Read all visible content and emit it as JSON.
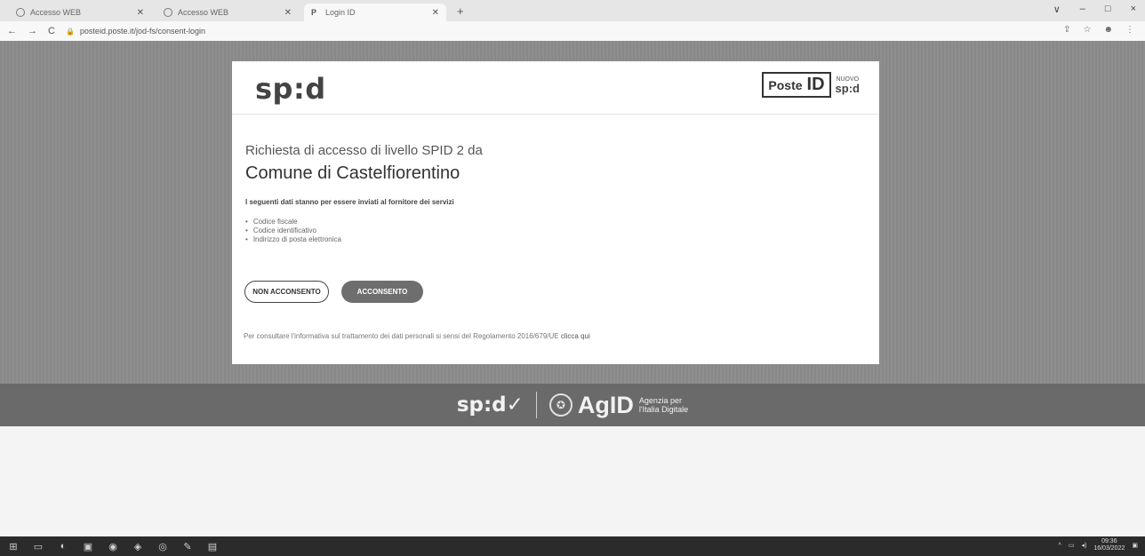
{
  "browser": {
    "tabs": [
      {
        "title": "Accesso WEB",
        "active": false
      },
      {
        "title": "Accesso WEB",
        "active": false
      },
      {
        "title": "Login ID",
        "active": true
      }
    ],
    "new_tab": "+",
    "url": "posteid.poste.it/jod-fs/consent-login",
    "window_controls": [
      "∨",
      "–",
      "□",
      "×"
    ]
  },
  "card": {
    "spid_logo": "sp:d",
    "posteid": {
      "poste": "Poste",
      "id": "ID",
      "nuovo": "NUOVO",
      "spid": "sp:d"
    },
    "request_line": "Richiesta di accesso di livello SPID 2 da",
    "organization": "Comune di Castelfiorentino",
    "intro": "I seguenti dati stanno per essere inviati al fornitore dei servizi",
    "attributes": [
      "Codice fiscale",
      "Codice identificativo",
      "Indirizzo di posta elettronica"
    ],
    "buttons": {
      "deny": "NON ACCONSENTO",
      "accept": "ACCONSENTO"
    },
    "privacy_text": "Per consultare l'informativa sul trattamento dei dati personali si sensi del Regolamento 2016/679/UE",
    "privacy_link": "clicca qui"
  },
  "footer": {
    "spid": "sp:d✓",
    "agid": "AgID",
    "agid_sub_1": "Agenzia per",
    "agid_sub_2": "l'Italia Digitale"
  },
  "taskbar": {
    "time": "09:36",
    "date": "16/03/2022"
  }
}
